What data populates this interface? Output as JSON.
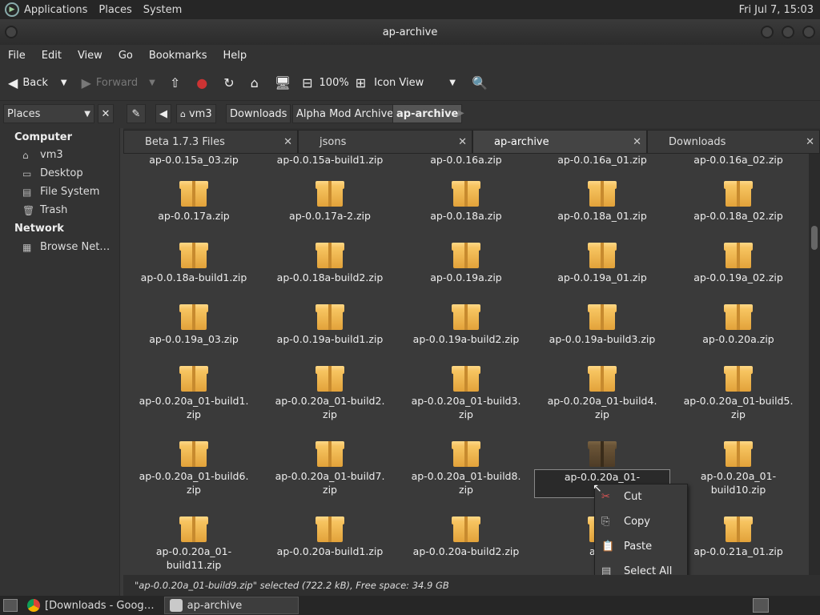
{
  "topbar": {
    "menus": [
      "Applications",
      "Places",
      "System"
    ],
    "clock": "Fri Jul  7, 15:03"
  },
  "window": {
    "title": "ap-archive"
  },
  "menubar": [
    "File",
    "Edit",
    "View",
    "Go",
    "Bookmarks",
    "Help"
  ],
  "toolbar": {
    "back": "Back",
    "forward": "Forward",
    "zoom": "100%",
    "view_mode": "Icon View"
  },
  "location": {
    "places_label": "Places",
    "crumbs": [
      "vm3",
      "Downloads",
      "Alpha Mod Archive",
      "ap-archive"
    ]
  },
  "sidebar": {
    "computer_header": "Computer",
    "computer_items": [
      "vm3",
      "Desktop",
      "File System",
      "Trash"
    ],
    "network_header": "Network",
    "network_items": [
      "Browse Net…"
    ]
  },
  "tabs": [
    "Beta 1.7.3 Files",
    "jsons",
    "ap-archive",
    "Downloads"
  ],
  "files_partial": [
    "ap-0.0.15a_03.zip",
    "ap-0.0.15a-build1.zip",
    "ap-0.0.16a.zip",
    "ap-0.0.16a_01.zip",
    "ap-0.0.16a_02.zip"
  ],
  "files": [
    [
      "ap-0.0.17a.zip",
      "ap-0.0.17a-2.zip",
      "ap-0.0.18a.zip",
      "ap-0.0.18a_01.zip",
      "ap-0.0.18a_02.zip"
    ],
    [
      "ap-0.0.18a-build1.zip",
      "ap-0.0.18a-build2.zip",
      "ap-0.0.19a.zip",
      "ap-0.0.19a_01.zip",
      "ap-0.0.19a_02.zip"
    ],
    [
      "ap-0.0.19a_03.zip",
      "ap-0.0.19a-build1.zip",
      "ap-0.0.19a-build2.zip",
      "ap-0.0.19a-build3.zip",
      "ap-0.0.20a.zip"
    ],
    [
      [
        "ap-0.0.20a_01-build1.",
        "zip"
      ],
      [
        "ap-0.0.20a_01-build2.",
        "zip"
      ],
      [
        "ap-0.0.20a_01-build3.",
        "zip"
      ],
      [
        "ap-0.0.20a_01-build4.",
        "zip"
      ],
      [
        "ap-0.0.20a_01-build5.",
        "zip"
      ]
    ],
    [
      [
        "ap-0.0.20a_01-build6.",
        "zip"
      ],
      [
        "ap-0.0.20a_01-build7.",
        "zip"
      ],
      [
        "ap-0.0.20a_01-build8.",
        "zip"
      ],
      [
        "ap-0.0.20a_01-",
        "bui"
      ],
      [
        "ap-0.0.20a_01-",
        "build10.zip"
      ]
    ],
    [
      [
        "ap-0.0.20a_01-",
        "build11.zip"
      ],
      [
        "ap-0.0.20a-build1.zip",
        ""
      ],
      [
        "ap-0.0.20a-build2.zip",
        ""
      ],
      [
        "ap-0.",
        ""
      ],
      [
        "ap-0.0.21a_01.zip",
        ""
      ]
    ]
  ],
  "context_menu": [
    "Cut",
    "Copy",
    "Paste",
    "Select All"
  ],
  "status": "\"ap-0.0.20a_01-build9.zip\" selected (722.2 kB), Free space: 34.9 GB",
  "taskbar": [
    "[Downloads - Goog…",
    "ap-archive"
  ]
}
